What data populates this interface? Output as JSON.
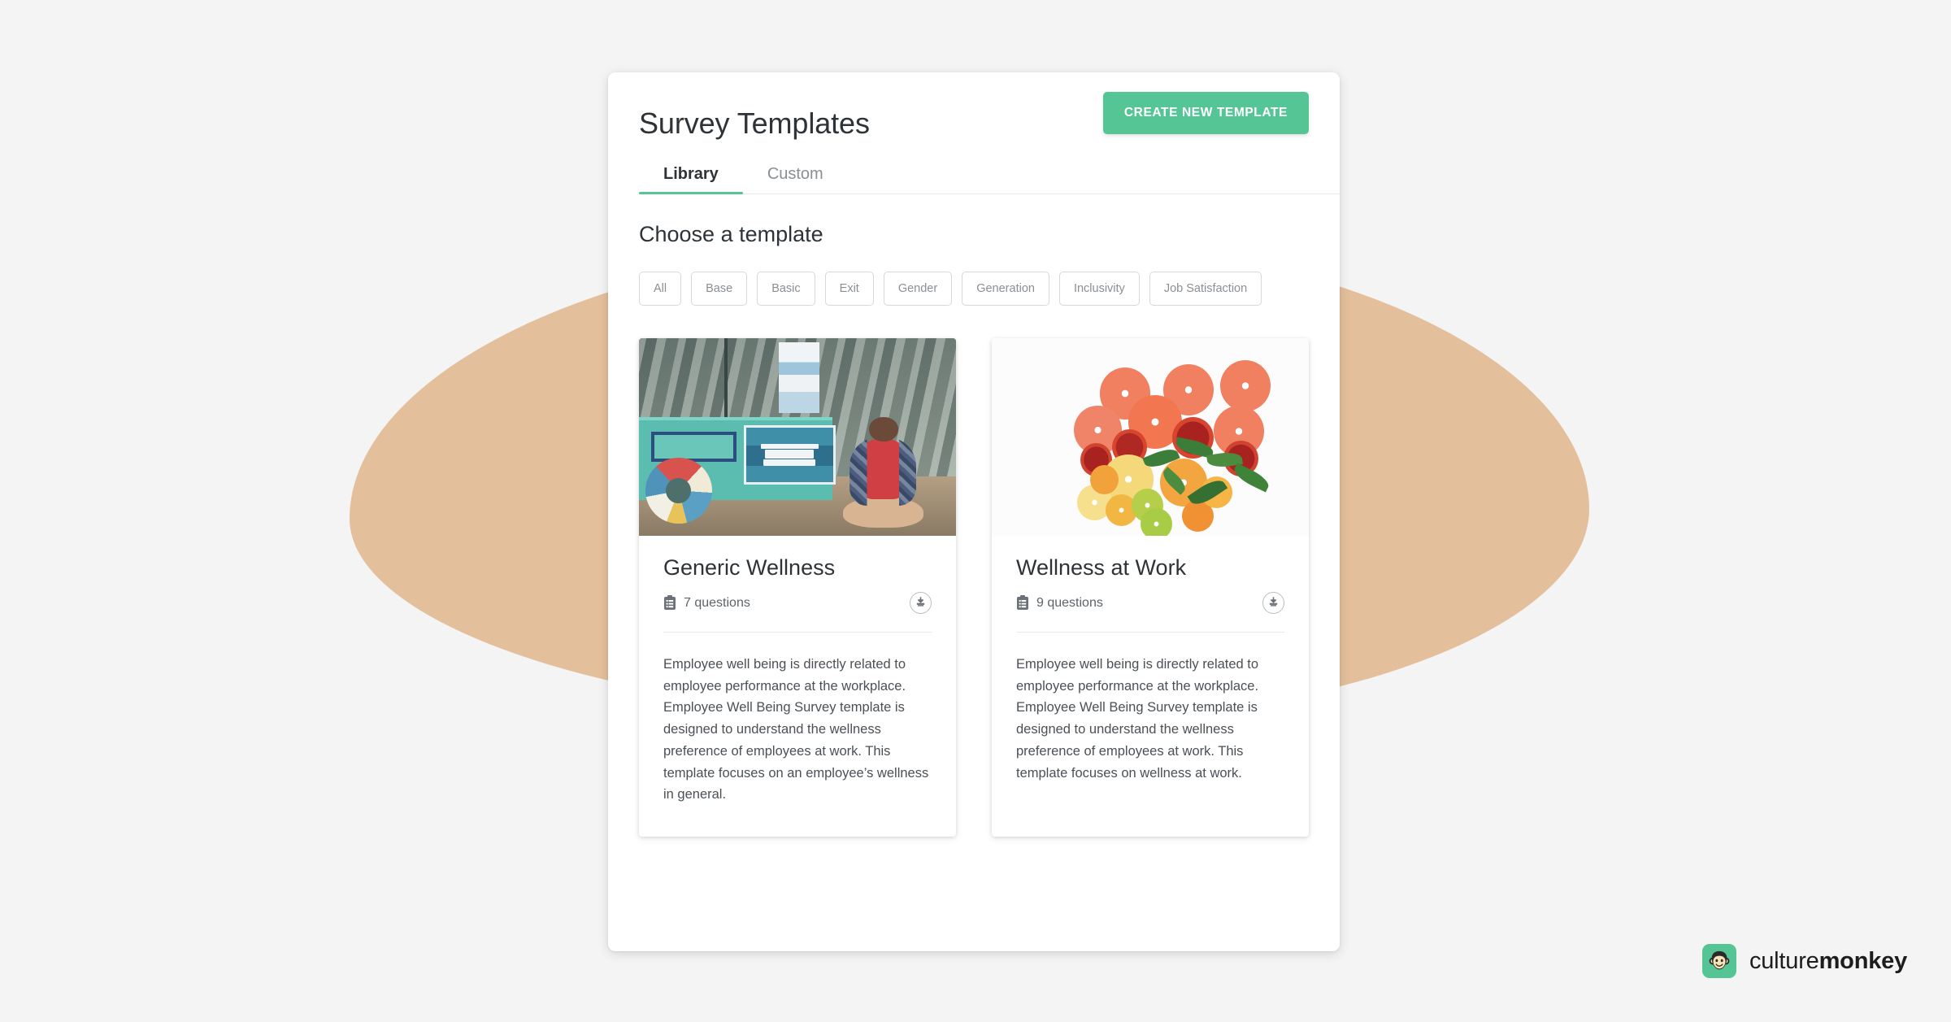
{
  "header": {
    "title": "Survey Templates",
    "create_button_label": "CREATE NEW TEMPLATE",
    "accent_color": "#56c596"
  },
  "tabs": [
    {
      "label": "Library",
      "active": true
    },
    {
      "label": "Custom",
      "active": false
    }
  ],
  "main": {
    "section_title": "Choose a template",
    "filters": [
      {
        "label": "All"
      },
      {
        "label": "Base"
      },
      {
        "label": "Basic"
      },
      {
        "label": "Exit"
      },
      {
        "label": "Gender"
      },
      {
        "label": "Generation"
      },
      {
        "label": "Inclusivity"
      },
      {
        "label": "Job Satisfaction"
      }
    ],
    "templates": [
      {
        "title": "Generic Wellness",
        "questions_label": "7 questions",
        "description": "Employee well being is directly related to employee performance at the workplace. Employee Well Being Survey template is designed to understand the wellness preference of employees at work. This template focuses on an employee’s wellness in general.",
        "image_alt": "woman sitting on beach sand beside teal van with THIS IS MY HAPPY PLACE sign and LIFE'S A BEACH life ring",
        "download_icon": "download-icon",
        "questions_icon": "clipboard-icon"
      },
      {
        "title": "Wellness at Work",
        "questions_label": "9 questions",
        "description": "Employee well being is directly related to employee performance at the workplace. Employee Well Being Survey template is designed to understand the wellness preference of employees at work. This template focuses on wellness at work.",
        "image_alt": "assorted citrus fruit slices arranged on a white background",
        "download_icon": "download-icon",
        "questions_icon": "clipboard-icon"
      }
    ]
  },
  "brand": {
    "name_light": "culture",
    "name_bold": "monkey",
    "mark_icon": "monkey-face-icon",
    "mark_color": "#56c596"
  },
  "background": {
    "page_color": "#f4f4f4",
    "blob_color": "#e4bf9b"
  }
}
